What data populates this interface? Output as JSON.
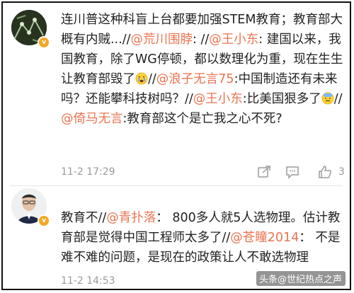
{
  "comments": [
    {
      "segments": [
        {
          "text": "连川普这种科盲上台都要加强STEM教育；教育部大概有内贼...//",
          "type": "text"
        },
        {
          "text": "@荒川围脖",
          "type": "mention"
        },
        {
          "text": ": //",
          "type": "text"
        },
        {
          "text": "@王小东",
          "type": "mention"
        },
        {
          "text": ": 建国以来，我国教育，除了WG停顿，都以数理化为重，现在生生让教育部毁了",
          "type": "text"
        },
        {
          "text": "crying-emoji",
          "type": "emoji"
        },
        {
          "text": "//",
          "type": "text"
        },
        {
          "text": "@浪子无言75",
          "type": "mention"
        },
        {
          "text": ":中国制造还有未来吗？还能攀科技树吗？//",
          "type": "text"
        },
        {
          "text": "@王小东",
          "type": "mention"
        },
        {
          "text": ":比美国狠多了",
          "type": "text"
        },
        {
          "text": "sweat-emoji",
          "type": "emoji"
        },
        {
          "text": "//",
          "type": "text"
        },
        {
          "text": "@倚马无言",
          "type": "mention"
        },
        {
          "text": ":教育部这个是亡我之心不死?",
          "type": "text"
        }
      ],
      "timestamp": "11-2 17:29",
      "like_count": "3"
    },
    {
      "segments": [
        {
          "text": "教育不//",
          "type": "text"
        },
        {
          "text": "@青扑落",
          "type": "mention"
        },
        {
          "text": "： 800多人就5人选物理。估计教育部是觉得中国工程师太多了//",
          "type": "text"
        },
        {
          "text": "@苍瞳2014",
          "type": "mention"
        },
        {
          "text": "： 不是难不难的问题，是现在的政策让人不敢选物理",
          "type": "text"
        }
      ],
      "timestamp": "11-2 14:53"
    }
  ],
  "icons": {
    "share": "share-icon",
    "comment": "comment-icon",
    "like": "like-icon",
    "verified": "verified-badge"
  },
  "watermark": "头条@世纪热点之声",
  "colors": {
    "mention": "#eb7350",
    "text": "#222222",
    "meta": "#9b9b9b",
    "verified": "#f6a623"
  }
}
